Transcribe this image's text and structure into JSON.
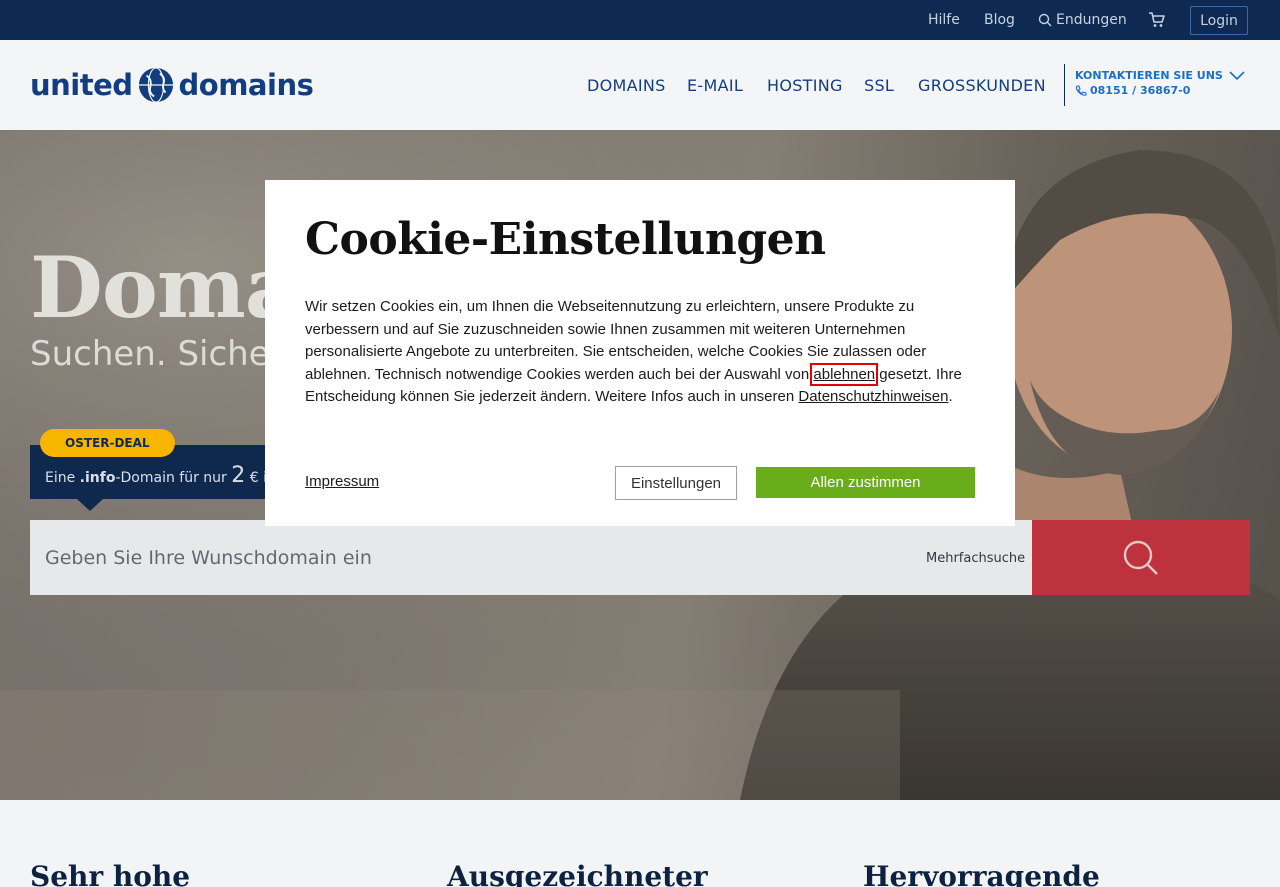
{
  "topbar": {
    "help": "Hilfe",
    "blog": "Blog",
    "endings": "Endungen",
    "login": "Login"
  },
  "header": {
    "logo_left": "united",
    "logo_right": "domains",
    "nav": [
      "DOMAINS",
      "E-MAIL",
      "HOSTING",
      "SSL",
      "GROSSKUNDEN"
    ],
    "contact_label": "KONTAKTIEREN SIE UNS",
    "contact_phone": "08151 / 36867-0"
  },
  "hero": {
    "title": "Domai",
    "subtitle": "Suchen. Sicher",
    "deal_badge": "OSTER-DEAL",
    "deal_prefix": "Eine ",
    "deal_tld": ".info",
    "deal_mid": "-Domain für nur ",
    "deal_price": "2",
    "deal_suffix": " € im",
    "search_placeholder": "Geben Sie Ihre Wunschdomain ein",
    "multi_search": "Mehrfachsuche"
  },
  "cookie_modal": {
    "title": "Cookie-Einstellungen",
    "text_1": "Wir setzen Cookies ein, um Ihnen die Webseitennutzung zu erleichtern, unsere Produkte zu verbessern und auf Sie zuzuschneiden sowie Ihnen zusammen mit weiteren Unternehmen personalisierte Angebote zu unterbreiten. Sie entscheiden, welche Cookies Sie zulassen oder ablehnen. Technisch notwendige Cookies werden auch bei der Auswahl von ",
    "reject_link": "ablehnen",
    "text_2": " gesetzt. Ihre Entscheidung können Sie jederzeit ändern. Weitere Infos auch in unseren ",
    "privacy_link": "Datenschutzhinweisen",
    "text_3": ".",
    "imprint": "Impressum",
    "settings_button": "Einstellungen",
    "accept_button": "Allen zustimmen"
  },
  "features": {
    "items": [
      "Sehr hohe",
      "Ausgezeichneter",
      "Hervorragende"
    ]
  },
  "colors": {
    "navy": "#0e2a52",
    "brand_blue": "#123d7e",
    "accept_green": "#6aad1a",
    "search_red": "#c8353f",
    "deal_yellow": "#f7b500",
    "highlight_red": "#e40000"
  },
  "icons": [
    "search-icon",
    "cart-icon",
    "globe-icon",
    "chevron-down-icon",
    "phone-icon",
    "search-button-icon"
  ]
}
